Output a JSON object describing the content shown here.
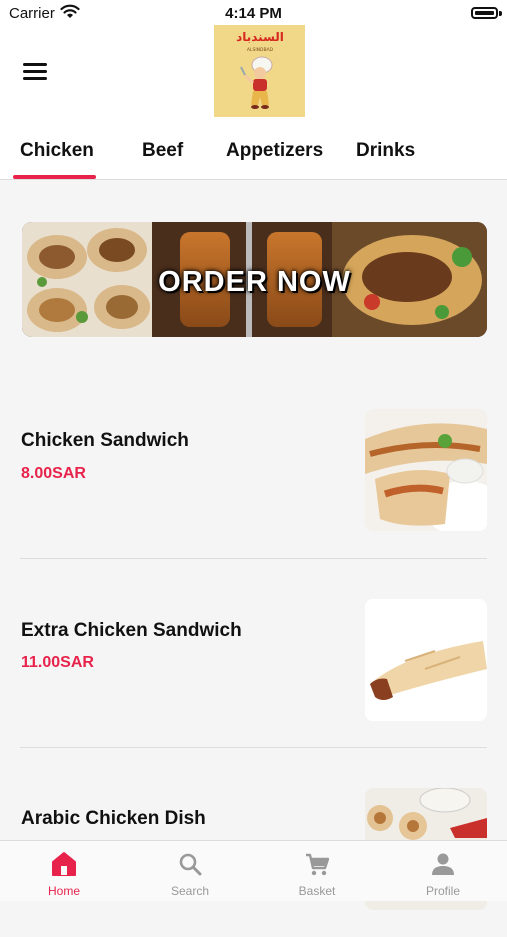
{
  "status_bar": {
    "carrier": "Carrier",
    "time": "4:14 PM"
  },
  "header": {
    "logo_text_arabic": "السندباد",
    "logo_text_latin": "ALSINDBAD"
  },
  "tabs": [
    {
      "label": "Chicken",
      "active": true
    },
    {
      "label": "Beef",
      "active": false
    },
    {
      "label": "Appetizers",
      "active": false
    },
    {
      "label": "Drinks",
      "active": false
    }
  ],
  "banner": {
    "text": "ORDER NOW"
  },
  "menu_items": [
    {
      "name": "Chicken Sandwich",
      "price": "8.00SAR"
    },
    {
      "name": "Extra Chicken Sandwich",
      "price": "11.00SAR"
    },
    {
      "name": "Arabic  Chicken Dish",
      "price": ""
    }
  ],
  "bottom_nav": [
    {
      "label": "Home",
      "icon": "home-icon",
      "active": true
    },
    {
      "label": "Search",
      "icon": "search-icon",
      "active": false
    },
    {
      "label": "Basket",
      "icon": "cart-icon",
      "active": false
    },
    {
      "label": "Profile",
      "icon": "person-icon",
      "active": false
    }
  ],
  "colors": {
    "accent": "#e8234b",
    "inactive": "#999999",
    "logo_bg": "#f1d889"
  }
}
